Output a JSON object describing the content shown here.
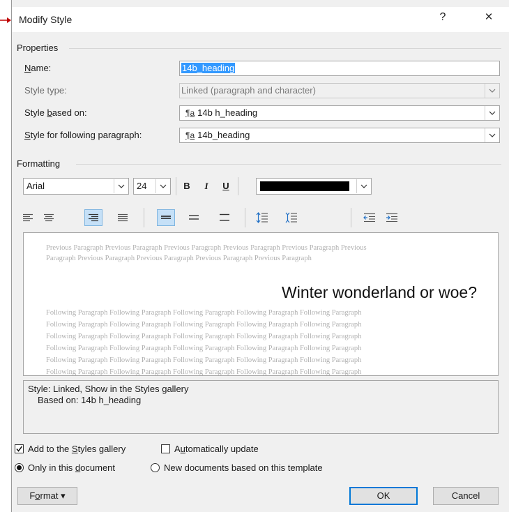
{
  "window": {
    "title": "Modify Style",
    "help_label": "?",
    "close_label": "×"
  },
  "properties": {
    "group_label": "Properties",
    "name": {
      "label_pre": "",
      "label_key": "N",
      "label_post": "ame:",
      "value": "14b_heading"
    },
    "style_type": {
      "label": "Style type:",
      "value": "Linked (paragraph and character)"
    },
    "based_on": {
      "label_pre": "Style ",
      "label_key": "b",
      "label_post": "ased on:",
      "icon": "¶a",
      "value": "14b h_heading"
    },
    "following": {
      "label_pre": "",
      "label_key": "S",
      "label_post": "tyle for following paragraph:",
      "icon": "¶a",
      "value": "14b_heading"
    }
  },
  "formatting": {
    "group_label": "Formatting",
    "font": "Arial",
    "size": "24",
    "bold": "B",
    "italic": "I",
    "underline": "U",
    "color": "#000000",
    "alignment_buttons": [
      {
        "name": "align-left",
        "active": false
      },
      {
        "name": "align-center",
        "active": false
      },
      {
        "name": "align-right",
        "active": true
      },
      {
        "name": "align-justify",
        "active": false
      }
    ],
    "spacing_buttons": [
      {
        "name": "single-spacing",
        "active": true
      },
      {
        "name": "one-half-spacing",
        "active": false
      },
      {
        "name": "double-spacing",
        "active": false
      }
    ]
  },
  "preview": {
    "previous_line1": "Previous Paragraph Previous Paragraph Previous Paragraph Previous Paragraph Previous Paragraph Previous",
    "previous_line2": "Paragraph Previous Paragraph Previous Paragraph Previous Paragraph Previous Paragraph",
    "sample_text": "Winter wonderland or woe?",
    "following_line": "Following Paragraph Following Paragraph Following Paragraph Following Paragraph Following Paragraph"
  },
  "description": {
    "line1": "Style: Linked, Show in the Styles gallery",
    "line2": "Based on: 14b h_heading"
  },
  "options": {
    "add_gallery": {
      "pre": "Add to the ",
      "key": "S",
      "post": "tyles gallery",
      "checked": true
    },
    "auto_update": {
      "pre": "A",
      "key": "u",
      "post": "tomatically update",
      "checked": false
    },
    "only_doc": {
      "pre": "Only in this ",
      "key": "d",
      "post": "ocument",
      "selected": true
    },
    "new_docs": {
      "label": "New documents based on this template",
      "selected": false
    }
  },
  "buttons": {
    "format_pre": "F",
    "format_key": "o",
    "format_post": "rmat ▾",
    "ok": "OK",
    "cancel": "Cancel"
  },
  "colors": {
    "arrow": "#c00000",
    "selection": "#3399ff",
    "active_button": "#c5e0f7"
  }
}
